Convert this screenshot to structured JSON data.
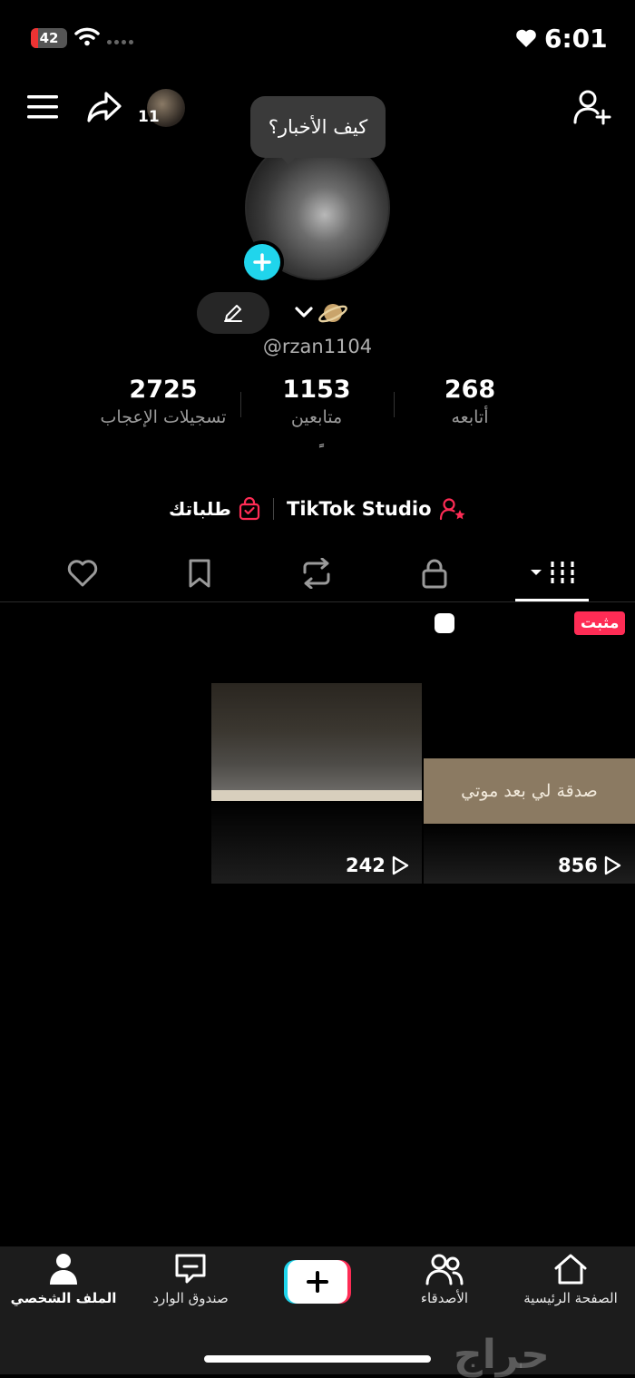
{
  "status_bar": {
    "battery_level": "42",
    "time": "6:01"
  },
  "header": {
    "avatar_badge_count": "11",
    "note_bubble": "كيف الأخبار؟"
  },
  "profile": {
    "username": "@rzan1104",
    "bio": "ً",
    "stats": [
      {
        "value": "2725",
        "label": "تسجيلات الإعجاب"
      },
      {
        "value": "1153",
        "label": "متابعين"
      },
      {
        "value": "268",
        "label": "أتابعه"
      }
    ],
    "links": {
      "orders": "طلباتك",
      "studio": "TikTok Studio"
    }
  },
  "tabs": [
    "liked",
    "favorites",
    "reposts",
    "private",
    "videos"
  ],
  "videos": [
    {
      "views": "856",
      "pinned_label": "مثبت",
      "overlay_text": "صدقة لي بعد موتي"
    },
    {
      "views": "242"
    }
  ],
  "bottom_nav": {
    "home": "الصفحة الرئيسية",
    "friends": "الأصدقاء",
    "inbox": "صندوق الوارد",
    "profile": "الملف الشخصي"
  },
  "watermark": "حراج",
  "colors": {
    "accent_pink": "#fe2c55",
    "accent_cyan": "#20d5ec",
    "background": "#000000",
    "nav_background": "#1c1c1c"
  }
}
